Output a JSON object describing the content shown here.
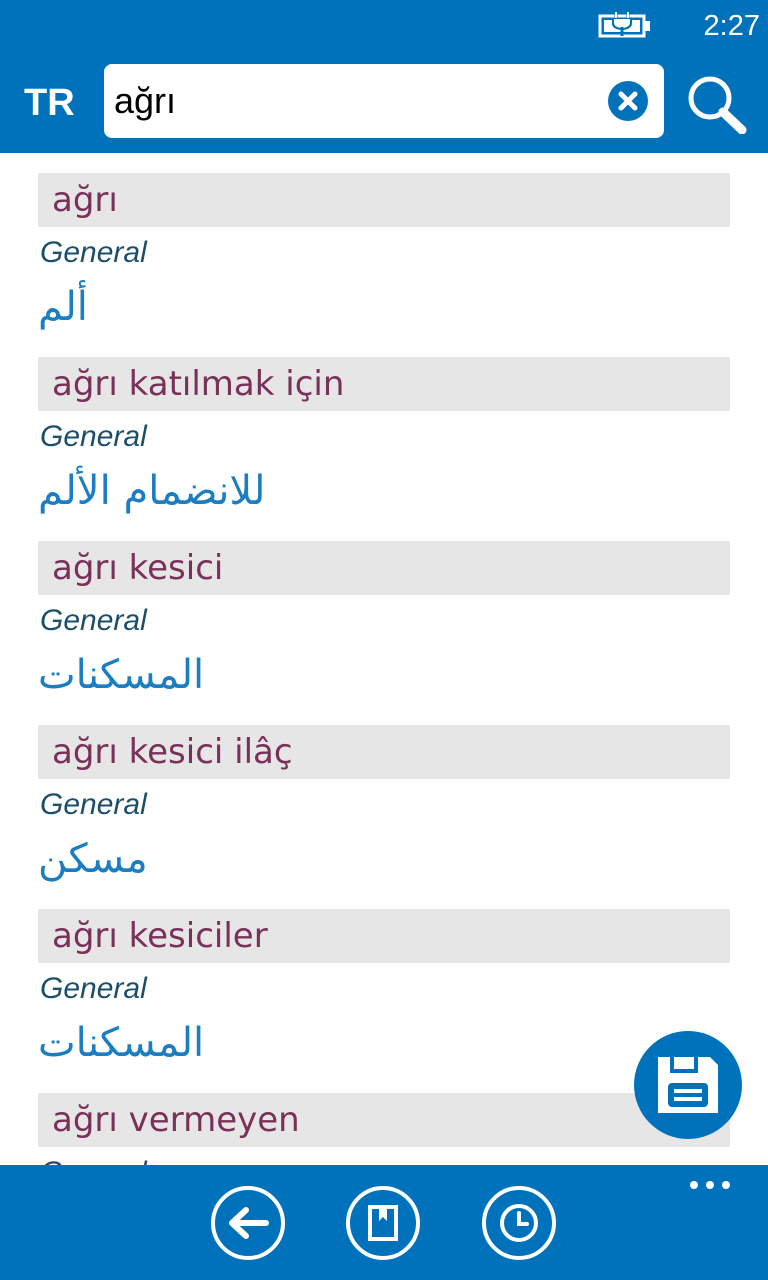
{
  "status_bar": {
    "time": "2:27",
    "battery_icon": "battery-charging-icon"
  },
  "header": {
    "language": "TR",
    "search": {
      "value": "ağrı",
      "placeholder": ""
    },
    "clear_icon": "clear-icon",
    "search_icon": "search-icon"
  },
  "results": [
    {
      "term": "ağrı",
      "category": "General",
      "translation": "ألم"
    },
    {
      "term": "ağrı katılmak için",
      "category": "General",
      "translation": "للانضمام الألم"
    },
    {
      "term": "ağrı kesici",
      "category": "General",
      "translation": "المسكنات"
    },
    {
      "term": "ağrı kesici ilâç",
      "category": "General",
      "translation": "مسكن"
    },
    {
      "term": "ağrı kesiciler",
      "category": "General",
      "translation": "المسكنات"
    },
    {
      "term": "ağrı vermeyen",
      "category": "General",
      "translation": ""
    }
  ],
  "app_bar": {
    "buttons": [
      "back-icon",
      "bookmark-icon",
      "history-icon"
    ],
    "more_icon": "more-icon"
  },
  "fab_icon": "save-icon",
  "colors": {
    "accent": "#0072bc",
    "term": "#7a3159",
    "category": "#1e4f6a",
    "translation": "#1b7ec2",
    "term_bar": "#e6e6e6"
  }
}
